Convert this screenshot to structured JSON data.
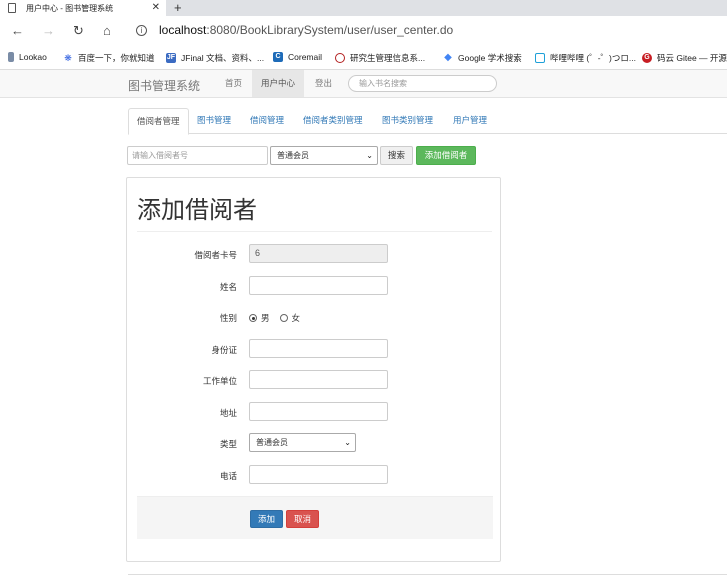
{
  "browser": {
    "tab_title": "用户中心 - 图书管理系统",
    "tab_close": "✕",
    "new_tab": "+",
    "url_host": "localhost",
    "url_path": ":8080/BookLibrarySystem/user/user_center.do",
    "bookmarks": [
      {
        "label": "Lookao",
        "icon": "lookao-icon",
        "color": "#7a8ca6"
      },
      {
        "label": "百度一下，你就知道",
        "icon": "baidu-paw-icon",
        "color": "#2f5fe0"
      },
      {
        "label": "JFinal 文档、资料、...",
        "icon": "jf-icon",
        "color": "#3b6bc2"
      },
      {
        "label": "Coremail",
        "icon": "coremail-icon",
        "color": "#1e6bb8"
      },
      {
        "label": "研究生管理信息系...",
        "icon": "university-seal-icon",
        "color": "#b32020"
      },
      {
        "label": "Google 学术搜索",
        "icon": "google-scholar-icon",
        "color": "#4285f4"
      },
      {
        "label": "哔哩哔哩 (゜-゜)つロ...",
        "icon": "bilibili-icon",
        "color": "#1ea0d8"
      },
      {
        "label": "码云 Gitee — 开源",
        "icon": "gitee-icon",
        "color": "#c71d23"
      }
    ]
  },
  "navbar": {
    "brand": "图书管理系统",
    "links": [
      "首页",
      "用户中心",
      "登出"
    ],
    "search_placeholder": "输入书名搜索"
  },
  "tabs": [
    "借阅者管理",
    "图书管理",
    "借阅管理",
    "借阅者类别管理",
    "图书类别管理",
    "用户管理"
  ],
  "toolbar": {
    "search_placeholder": "请输入借阅者号",
    "select_value": "普通会员",
    "search_button": "搜索",
    "add_button": "添加借阅者"
  },
  "form": {
    "title": "添加借阅者",
    "card_label": "借阅者卡号",
    "card_value": "6",
    "name_label": "姓名",
    "gender_label": "性别",
    "gender_male": "男",
    "gender_female": "女",
    "id_label": "身份证",
    "work_label": "工作单位",
    "address_label": "地址",
    "type_label": "类型",
    "type_value": "普通会员",
    "phone_label": "电话",
    "submit_button": "添加",
    "cancel_button": "取消"
  }
}
